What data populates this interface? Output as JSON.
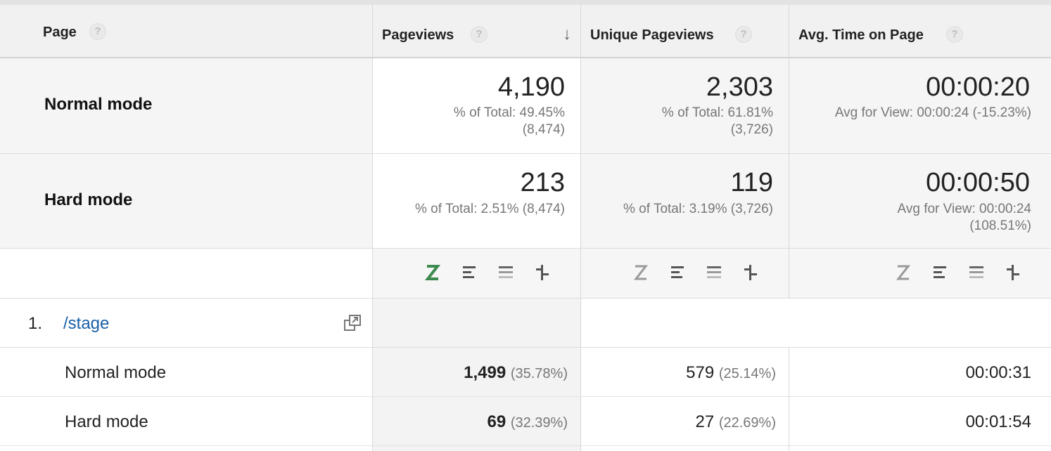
{
  "header": {
    "page_label": "Page",
    "pageviews_label": "Pageviews",
    "unique_label": "Unique Pageviews",
    "avgtime_label": "Avg. Time on Page",
    "help_glyph": "?",
    "sort_glyph": "↓"
  },
  "segments": [
    {
      "name": "Normal mode",
      "pageviews": "4,190",
      "pageviews_sub": [
        "% of Total: 49.45%",
        "(8,474)"
      ],
      "unique": "2,303",
      "unique_sub": [
        "% of Total: 61.81%",
        "(3,726)"
      ],
      "avgtime": "00:00:20",
      "avgtime_sub": [
        "Avg for View: 00:00:24 (-15.23%)"
      ]
    },
    {
      "name": "Hard mode",
      "pageviews": "213",
      "pageviews_sub": [
        "% of Total: 2.51% (8,474)"
      ],
      "unique": "119",
      "unique_sub": [
        "% of Total: 3.19% (3,726)"
      ],
      "avgtime": "00:00:50",
      "avgtime_sub": [
        "Avg for View: 00:00:24",
        "(108.51%)"
      ]
    }
  ],
  "viz_icons": [
    "z-icon",
    "bars-icon",
    "stacked-bars-icon",
    "comparison-icon"
  ],
  "rows": [
    {
      "index": "1.",
      "page": "/stage",
      "subrows": [
        {
          "segment": "Normal mode",
          "pageviews": "1,499",
          "pageviews_pct": "(35.78%)",
          "unique": "579",
          "unique_pct": "(25.14%)",
          "avgtime": "00:00:31"
        },
        {
          "segment": "Hard mode",
          "pageviews": "69",
          "pageviews_pct": "(32.39%)",
          "unique": "27",
          "unique_pct": "(22.69%)",
          "avgtime": "00:01:54"
        }
      ]
    }
  ],
  "colors": {
    "link": "#1a5fa8",
    "active_icon": "#2e8b57"
  }
}
